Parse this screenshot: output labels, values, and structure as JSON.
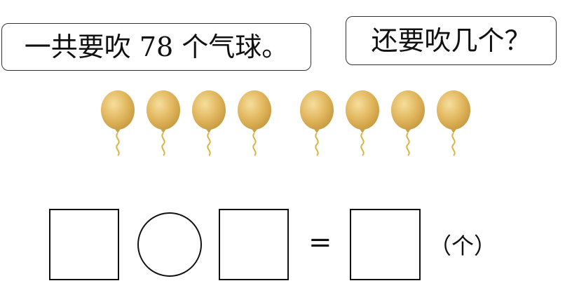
{
  "speech": {
    "left": "一共要吹 78 个气球。",
    "right": "还要吹几个？"
  },
  "balloons": {
    "count": 8,
    "color": "#e2b860",
    "string_color": "#d9b442"
  },
  "equation": {
    "equals": "=",
    "unit": "（个）"
  }
}
